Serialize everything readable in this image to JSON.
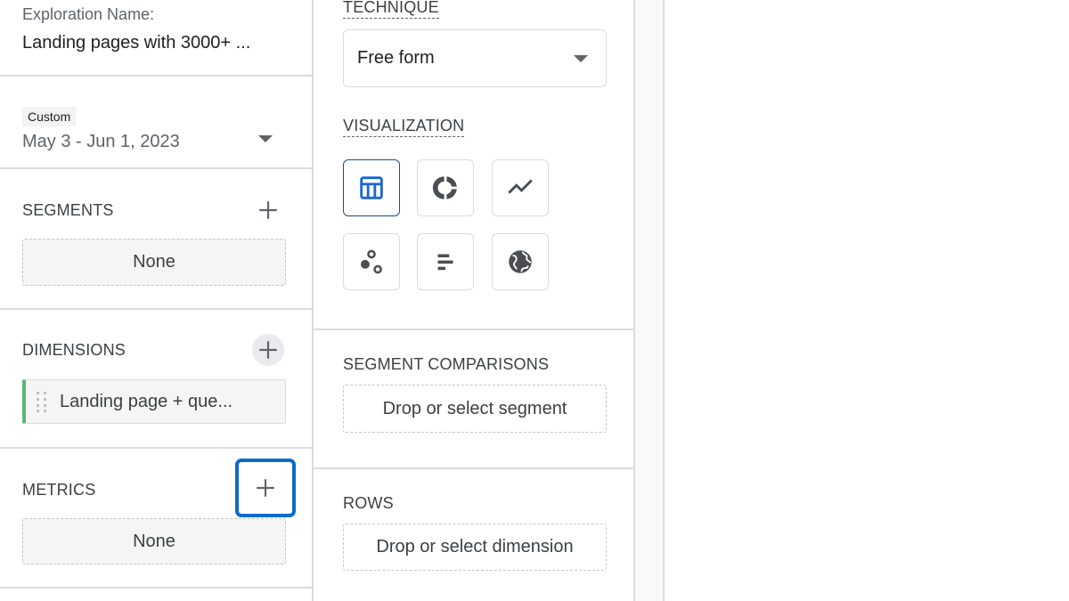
{
  "left": {
    "exploration_label": "Exploration Name:",
    "exploration_name": "Landing pages with 3000+ ...",
    "date_badge": "Custom",
    "date_range": "May 3 - Jun 1, 2023",
    "segments": {
      "title": "SEGMENTS",
      "value": "None"
    },
    "dimensions": {
      "title": "DIMENSIONS",
      "items": [
        "Landing page + que..."
      ]
    },
    "metrics": {
      "title": "METRICS",
      "value": "None"
    }
  },
  "mid": {
    "technique_title": "TECHNIQUE",
    "technique_value": "Free form",
    "visualization_title": "VISUALIZATION",
    "visualizations": [
      "table-icon",
      "donut-chart-icon",
      "line-chart-icon",
      "scatter-plot-icon",
      "bar-chart-icon",
      "geo-map-icon"
    ],
    "segment_comparisons_title": "SEGMENT COMPARISONS",
    "segment_drop": "Drop or select segment",
    "rows_title": "ROWS",
    "rows_drop": "Drop or select dimension"
  },
  "colors": {
    "accent": "#1967d2",
    "focus": "#0b6bcb",
    "dimension_bar": "#5bb974"
  }
}
